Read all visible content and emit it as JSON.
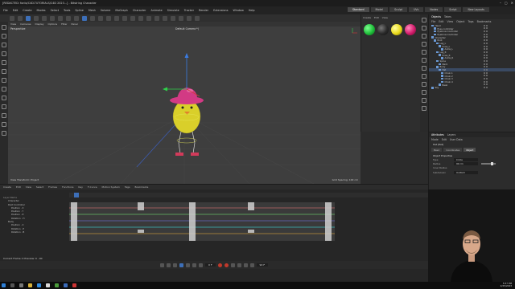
{
  "window": {
    "title": "[REDACTED: fonts/C4D-TUTORIALS/C4D 2023...] - Bitstring Character",
    "controls": [
      "–",
      "▢",
      "✕"
    ]
  },
  "menubar": {
    "items": [
      "File",
      "Edit",
      "Create",
      "Modes",
      "Select",
      "Tools",
      "Spline",
      "Mesh",
      "Volume",
      "MoGraph",
      "Character",
      "Animate",
      "Simulate",
      "Tracker",
      "Render",
      "Extensions",
      "Window",
      "Help"
    ],
    "layouts": [
      "Standard",
      "Model",
      "Sculpt",
      "UVs",
      "Nodes",
      "Script"
    ],
    "active_layout": "Standard",
    "new_layouts": "New Layouts"
  },
  "viewport": {
    "menu": [
      "View",
      "Cameras",
      "Display",
      "Options",
      "Filter",
      "Panel"
    ],
    "label": "Perspective",
    "camera": "Default Camera *)",
    "status_left": "View Transform: Project",
    "status_right": "Grid Spacing: 100 cm"
  },
  "materials": {
    "menu": [
      "Create",
      "Edit",
      "View"
    ],
    "swatches": [
      "#1fbf3a",
      "#2a2a2a",
      "#e8d81a",
      "#d21b6b"
    ]
  },
  "objects": {
    "tabs": [
      "Objects",
      "Takes"
    ],
    "subtabs": [
      "File",
      "Edit",
      "View",
      "Object",
      "Tags",
      "Bookmarks"
    ],
    "rows": [
      {
        "label": "Head",
        "indent": 0,
        "selected": false
      },
      {
        "label": "Eyes controller",
        "indent": 1,
        "selected": false
      },
      {
        "label": "Eyebrow Controller",
        "indent": 1,
        "selected": false
      },
      {
        "label": "Eyebrow Controller",
        "indent": 1,
        "selected": false
      },
      {
        "label": "Character",
        "indent": 0,
        "selected": false
      },
      {
        "label": "Root",
        "indent": 1,
        "selected": false
      },
      {
        "label": "Leg_L",
        "indent": 2,
        "selected": false
      },
      {
        "label": "Knee_L",
        "indent": 3,
        "selected": false
      },
      {
        "label": "Ankle_L",
        "indent": 4,
        "selected": false
      },
      {
        "label": "Leg_R",
        "indent": 2,
        "selected": false
      },
      {
        "label": "Knee_R",
        "indent": 3,
        "selected": false
      },
      {
        "label": "Ankle_R",
        "indent": 4,
        "selected": false
      },
      {
        "label": "Spine",
        "indent": 2,
        "selected": false
      },
      {
        "label": "Neck",
        "indent": 3,
        "selected": false
      },
      {
        "label": "Body",
        "indent": 2,
        "selected": false
      },
      {
        "label": "Hat",
        "indent": 3,
        "selected": true
      },
      {
        "label": "Chain.1",
        "indent": 4,
        "selected": false
      },
      {
        "label": "Chain.2",
        "indent": 4,
        "selected": false
      },
      {
        "label": "Chain.3",
        "indent": 4,
        "selected": false
      },
      {
        "label": "Chain.4",
        "indent": 4,
        "selected": false
      },
      {
        "label": "Beak",
        "indent": 3,
        "selected": false
      },
      {
        "label": "Sky",
        "indent": 0,
        "selected": false
      }
    ]
  },
  "attributes": {
    "tabs": [
      "Attributes",
      "Layers"
    ],
    "menu": [
      "Mode",
      "Edit",
      "User Data"
    ],
    "object_label": "Hat [Hat]",
    "subtabs": [
      "Basic",
      "Coordinates",
      "Object"
    ],
    "active_subtab": "Object",
    "section": "Object Properties",
    "fields": [
      {
        "key": "Type",
        "value": "Circle"
      },
      {
        "key": "Radius",
        "value": "90 cm"
      },
      {
        "key": "Inner Radius",
        "value": ""
      },
      {
        "key": "Subdivision",
        "value": "Uniform"
      }
    ]
  },
  "timeline": {
    "menu": [
      "Create",
      "Edit",
      "View",
      "Select",
      "Frames",
      "Functions",
      "Key",
      "F-Curve",
      "Motion System",
      "Tags",
      "Bookmarks"
    ],
    "tracks_header": "Layer Name",
    "tracks": [
      "Character",
      "Root Controller",
      "Position . X",
      "Position . Y",
      "Position . Z",
      "Rotation . H",
      "Body",
      "Position . X",
      "Rotation . P",
      "Rotation . B"
    ],
    "status": "Current Frame: 0  Preview: 0 - 90",
    "frame_field": "0 F",
    "end_field": "90 F"
  },
  "taskbar": {
    "time": "5:57 PM",
    "date": "2/25/2023"
  },
  "accent": "#3d6fb8"
}
